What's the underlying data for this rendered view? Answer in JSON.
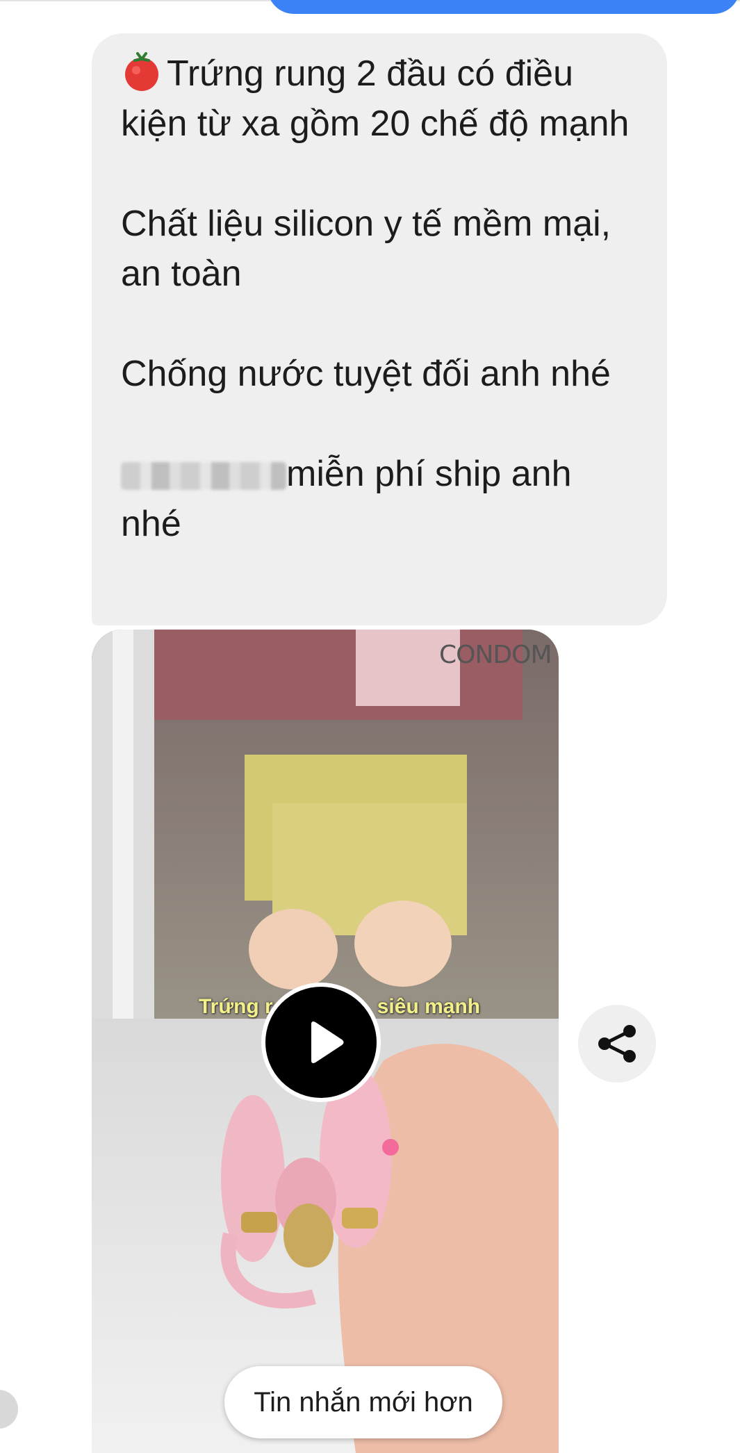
{
  "message": {
    "icon": "tomato-emoji",
    "paragraphs": [
      "Trứng rung 2 đầu có điều kiện từ xa gồm 20 chế độ mạnh",
      "Chất liệu silicon y tế mềm mại, an toàn",
      "Chống nước tuyệt đối anh nhé",
      "miễn phí ship anh nhé"
    ]
  },
  "video": {
    "caption_left": "Trứng r",
    "caption_right": "siêu mạnh",
    "background_label": "CONDOM"
  },
  "actions": {
    "play_icon": "play-icon",
    "share_icon": "share-icon",
    "newer_messages_label": "Tin nhắn mới hơn"
  },
  "colors": {
    "bubble_bg": "#efefef",
    "sent_bubble": "#3b82f6",
    "text": "#1c1c1c"
  }
}
